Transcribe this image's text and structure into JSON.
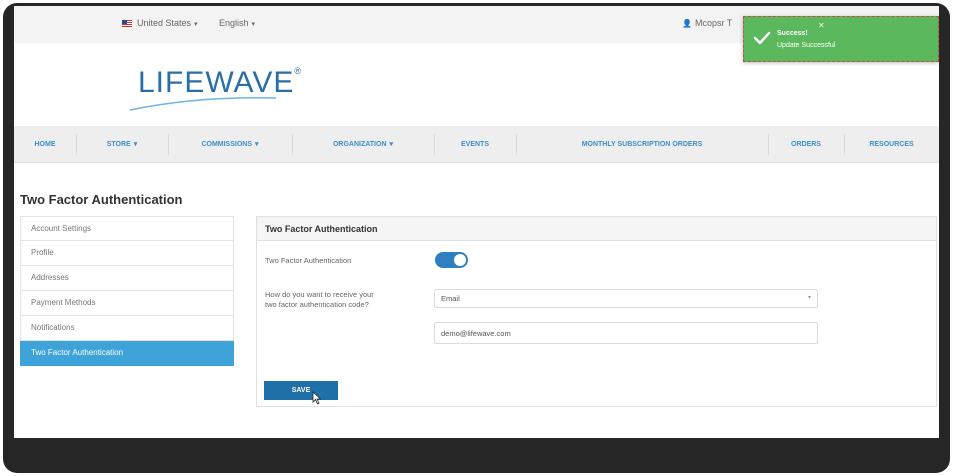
{
  "topbar": {
    "country": "United States",
    "language": "English",
    "user": "Mcopsr T"
  },
  "logo": {
    "text": "LIFEWAVE",
    "reg": "®"
  },
  "nav": {
    "items": [
      {
        "label": "HOME"
      },
      {
        "label": "STORE"
      },
      {
        "label": "COMMISSIONS"
      },
      {
        "label": "ORGANIZATION"
      },
      {
        "label": "EVENTS"
      },
      {
        "label": "MONTHLY SUBSCRIPTION ORDERS"
      },
      {
        "label": "ORDERS"
      },
      {
        "label": "RESOURCES"
      }
    ]
  },
  "page": {
    "title": "Two Factor Authentication"
  },
  "sidebar": {
    "items": [
      {
        "label": "Account Settings"
      },
      {
        "label": "Profile"
      },
      {
        "label": "Addresses"
      },
      {
        "label": "Payment Methods"
      },
      {
        "label": "Notifications"
      },
      {
        "label": "Two Factor Authentication"
      }
    ],
    "active_index": 5
  },
  "panel": {
    "title": "Two Factor Authentication",
    "toggle_label": "Two Factor Authentication",
    "toggle_on": true,
    "method_label_line1": "How do you want to receive your",
    "method_label_line2": "two factor authentication code?",
    "method_value": "Email",
    "email_value": "demo@lifewave.com",
    "save_label": "SAVE"
  },
  "toast": {
    "title": "Success!",
    "message": "Update Successful",
    "color": "#5cb85c"
  },
  "colors": {
    "accent": "#3ea3d8",
    "primary_button": "#1f6fa8",
    "nav_text": "#3b8fc6"
  }
}
